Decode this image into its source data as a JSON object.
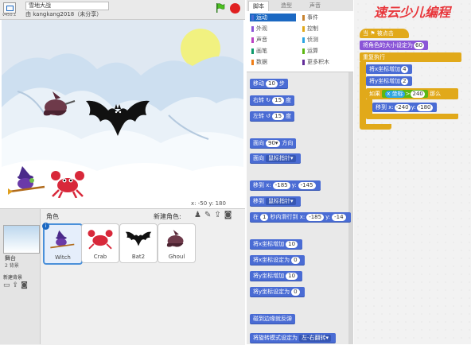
{
  "header": {
    "version": "v450.1",
    "project_title": "雪地大战",
    "author": "由 kangkang2018（未分享）"
  },
  "stage": {
    "coords": "x: -50   y: 180"
  },
  "sprites_pane": {
    "title": "角色",
    "new_sprite_label": "新建角色:",
    "stage_label": "舞台",
    "stage_bg_count": "2 背景",
    "new_backdrop_label": "新建背景",
    "sprites": [
      {
        "name": "Witch",
        "selected": true
      },
      {
        "name": "Crab",
        "selected": false
      },
      {
        "name": "Bat2",
        "selected": false
      },
      {
        "name": "Ghoul",
        "selected": false
      }
    ]
  },
  "tabs": [
    "脚本",
    "造型",
    "声音"
  ],
  "categories": [
    {
      "label": "运动",
      "color": "#4a6cd4",
      "active": true
    },
    {
      "label": "外观",
      "color": "#8a55d7",
      "active": false
    },
    {
      "label": "声音",
      "color": "#bb42c3",
      "active": false
    },
    {
      "label": "画笔",
      "color": "#0e9a6c",
      "active": false
    },
    {
      "label": "数据",
      "color": "#ee7d16",
      "active": false
    },
    {
      "label": "事件",
      "color": "#c88330",
      "active": false
    },
    {
      "label": "控制",
      "color": "#e1a91a",
      "active": false
    },
    {
      "label": "侦测",
      "color": "#2ca5e2",
      "active": false
    },
    {
      "label": "运算",
      "color": "#5cb712",
      "active": false
    },
    {
      "label": "更多积木",
      "color": "#632d99",
      "active": false
    }
  ],
  "palette": {
    "move": {
      "pre": "移动",
      "v": "10",
      "post": "步"
    },
    "turn_right": {
      "pre": "右转",
      "v": "15",
      "post": "度"
    },
    "turn_left": {
      "pre": "左转",
      "v": "15",
      "post": "度"
    },
    "point_dir": {
      "pre": "面向",
      "v": "90▾",
      "post": "方向"
    },
    "point_towards": {
      "pre": "面向",
      "v": "鼠标指针▾"
    },
    "goto_xy": {
      "pre": "移到 x:",
      "x": "-185",
      "mid": "y:",
      "y": "-145"
    },
    "goto": {
      "pre": "移到",
      "v": "鼠标指针▾"
    },
    "glide": {
      "pre": "在",
      "t": "1",
      "mid1": "秒内滑行到 x:",
      "x": "-185",
      "mid2": "y:",
      "y": "-14"
    },
    "change_x": {
      "pre": "将x坐标增加",
      "v": "10"
    },
    "set_x": {
      "pre": "将x坐标设定为",
      "v": "0"
    },
    "change_y": {
      "pre": "将y坐标增加",
      "v": "10"
    },
    "set_y": {
      "pre": "将y坐标设定为",
      "v": "0"
    },
    "bounce": "碰到边缘就反弹",
    "rotation_style": {
      "pre": "将旋转模式设定为",
      "v": "左-右翻转▾"
    }
  },
  "script": {
    "when_flag": "当 ⚑ 被点击",
    "set_size": {
      "pre": "将角色的大小设定为",
      "v": "60"
    },
    "forever": "重复执行",
    "change_x": {
      "pre": "将x坐标增加",
      "v": "4"
    },
    "change_y": {
      "pre": "将y坐标增加",
      "v": "2"
    },
    "if_label": "如果",
    "cond_left": "x 坐标",
    "cond_op": ">",
    "cond_right": "240",
    "then_label": "那么",
    "goto": {
      "pre": "移到 x:",
      "x": "-240",
      "mid": "y:",
      "y": "-180"
    }
  },
  "watermark": "速云少儿编程"
}
